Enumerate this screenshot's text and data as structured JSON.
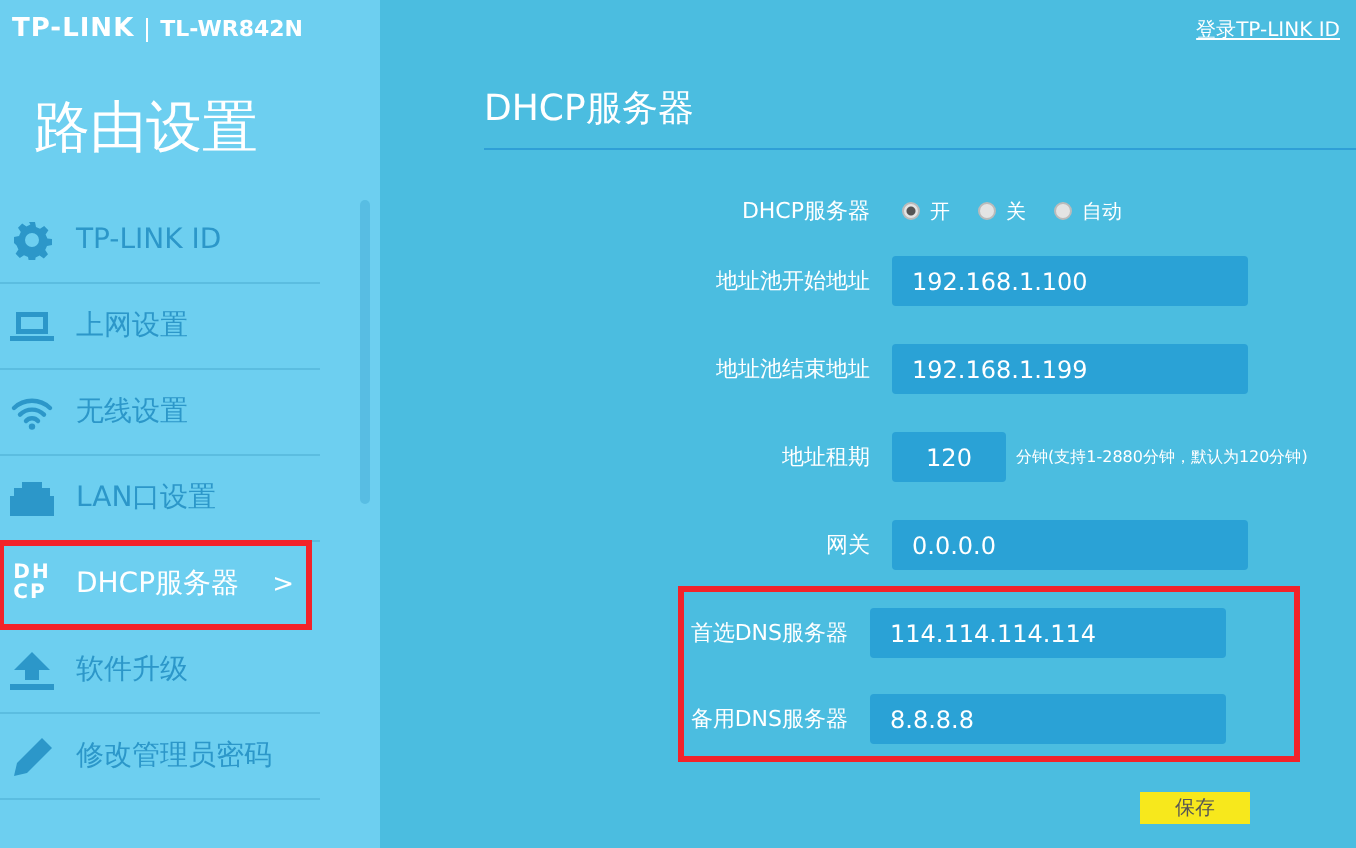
{
  "header": {
    "brand": "TP-LINK",
    "model": "TL-WR842N",
    "login_link": "登录TP-LINK ID"
  },
  "sidebar": {
    "title": "路由设置",
    "items": [
      {
        "label": "TP-LINK ID",
        "kind": "gear",
        "selected": false,
        "highlighted": false
      },
      {
        "label": "上网设置",
        "kind": "laptop",
        "selected": false,
        "highlighted": false
      },
      {
        "label": "无线设置",
        "kind": "wifi",
        "selected": false,
        "highlighted": false
      },
      {
        "label": "LAN口设置",
        "kind": "port",
        "selected": false,
        "highlighted": false
      },
      {
        "label": "DHCP服务器",
        "kind": "text",
        "icon_lines": [
          "DH",
          "CP"
        ],
        "selected": true,
        "highlighted": true,
        "chevron": ">"
      },
      {
        "label": "软件升级",
        "kind": "upload",
        "selected": false,
        "highlighted": false
      },
      {
        "label": "修改管理员密码",
        "kind": "pencil",
        "selected": false,
        "highlighted": false
      }
    ]
  },
  "page_title": "DHCP服务器",
  "form": {
    "rows": [
      {
        "kind": "radio",
        "label": "DHCP服务器",
        "options": [
          {
            "label": "开",
            "selected": true
          },
          {
            "label": "关",
            "selected": false
          },
          {
            "label": "自动",
            "selected": false
          }
        ]
      },
      {
        "kind": "input",
        "label": "地址池开始地址",
        "value": "192.168.1.100"
      },
      {
        "kind": "input",
        "label": "地址池结束地址",
        "value": "192.168.1.199"
      },
      {
        "kind": "short",
        "label": "地址租期",
        "value": "120",
        "note": "分钟(支持1-2880分钟，默认为120分钟)"
      },
      {
        "kind": "input",
        "label": "网关",
        "value": "0.0.0.0"
      }
    ],
    "dns_group": {
      "highlighted": true,
      "rows": [
        {
          "label": "首选DNS服务器",
          "value": "114.114.114.114"
        },
        {
          "label": "备用DNS服务器",
          "value": "8.8.8.8"
        }
      ]
    },
    "save_button": "保存"
  }
}
